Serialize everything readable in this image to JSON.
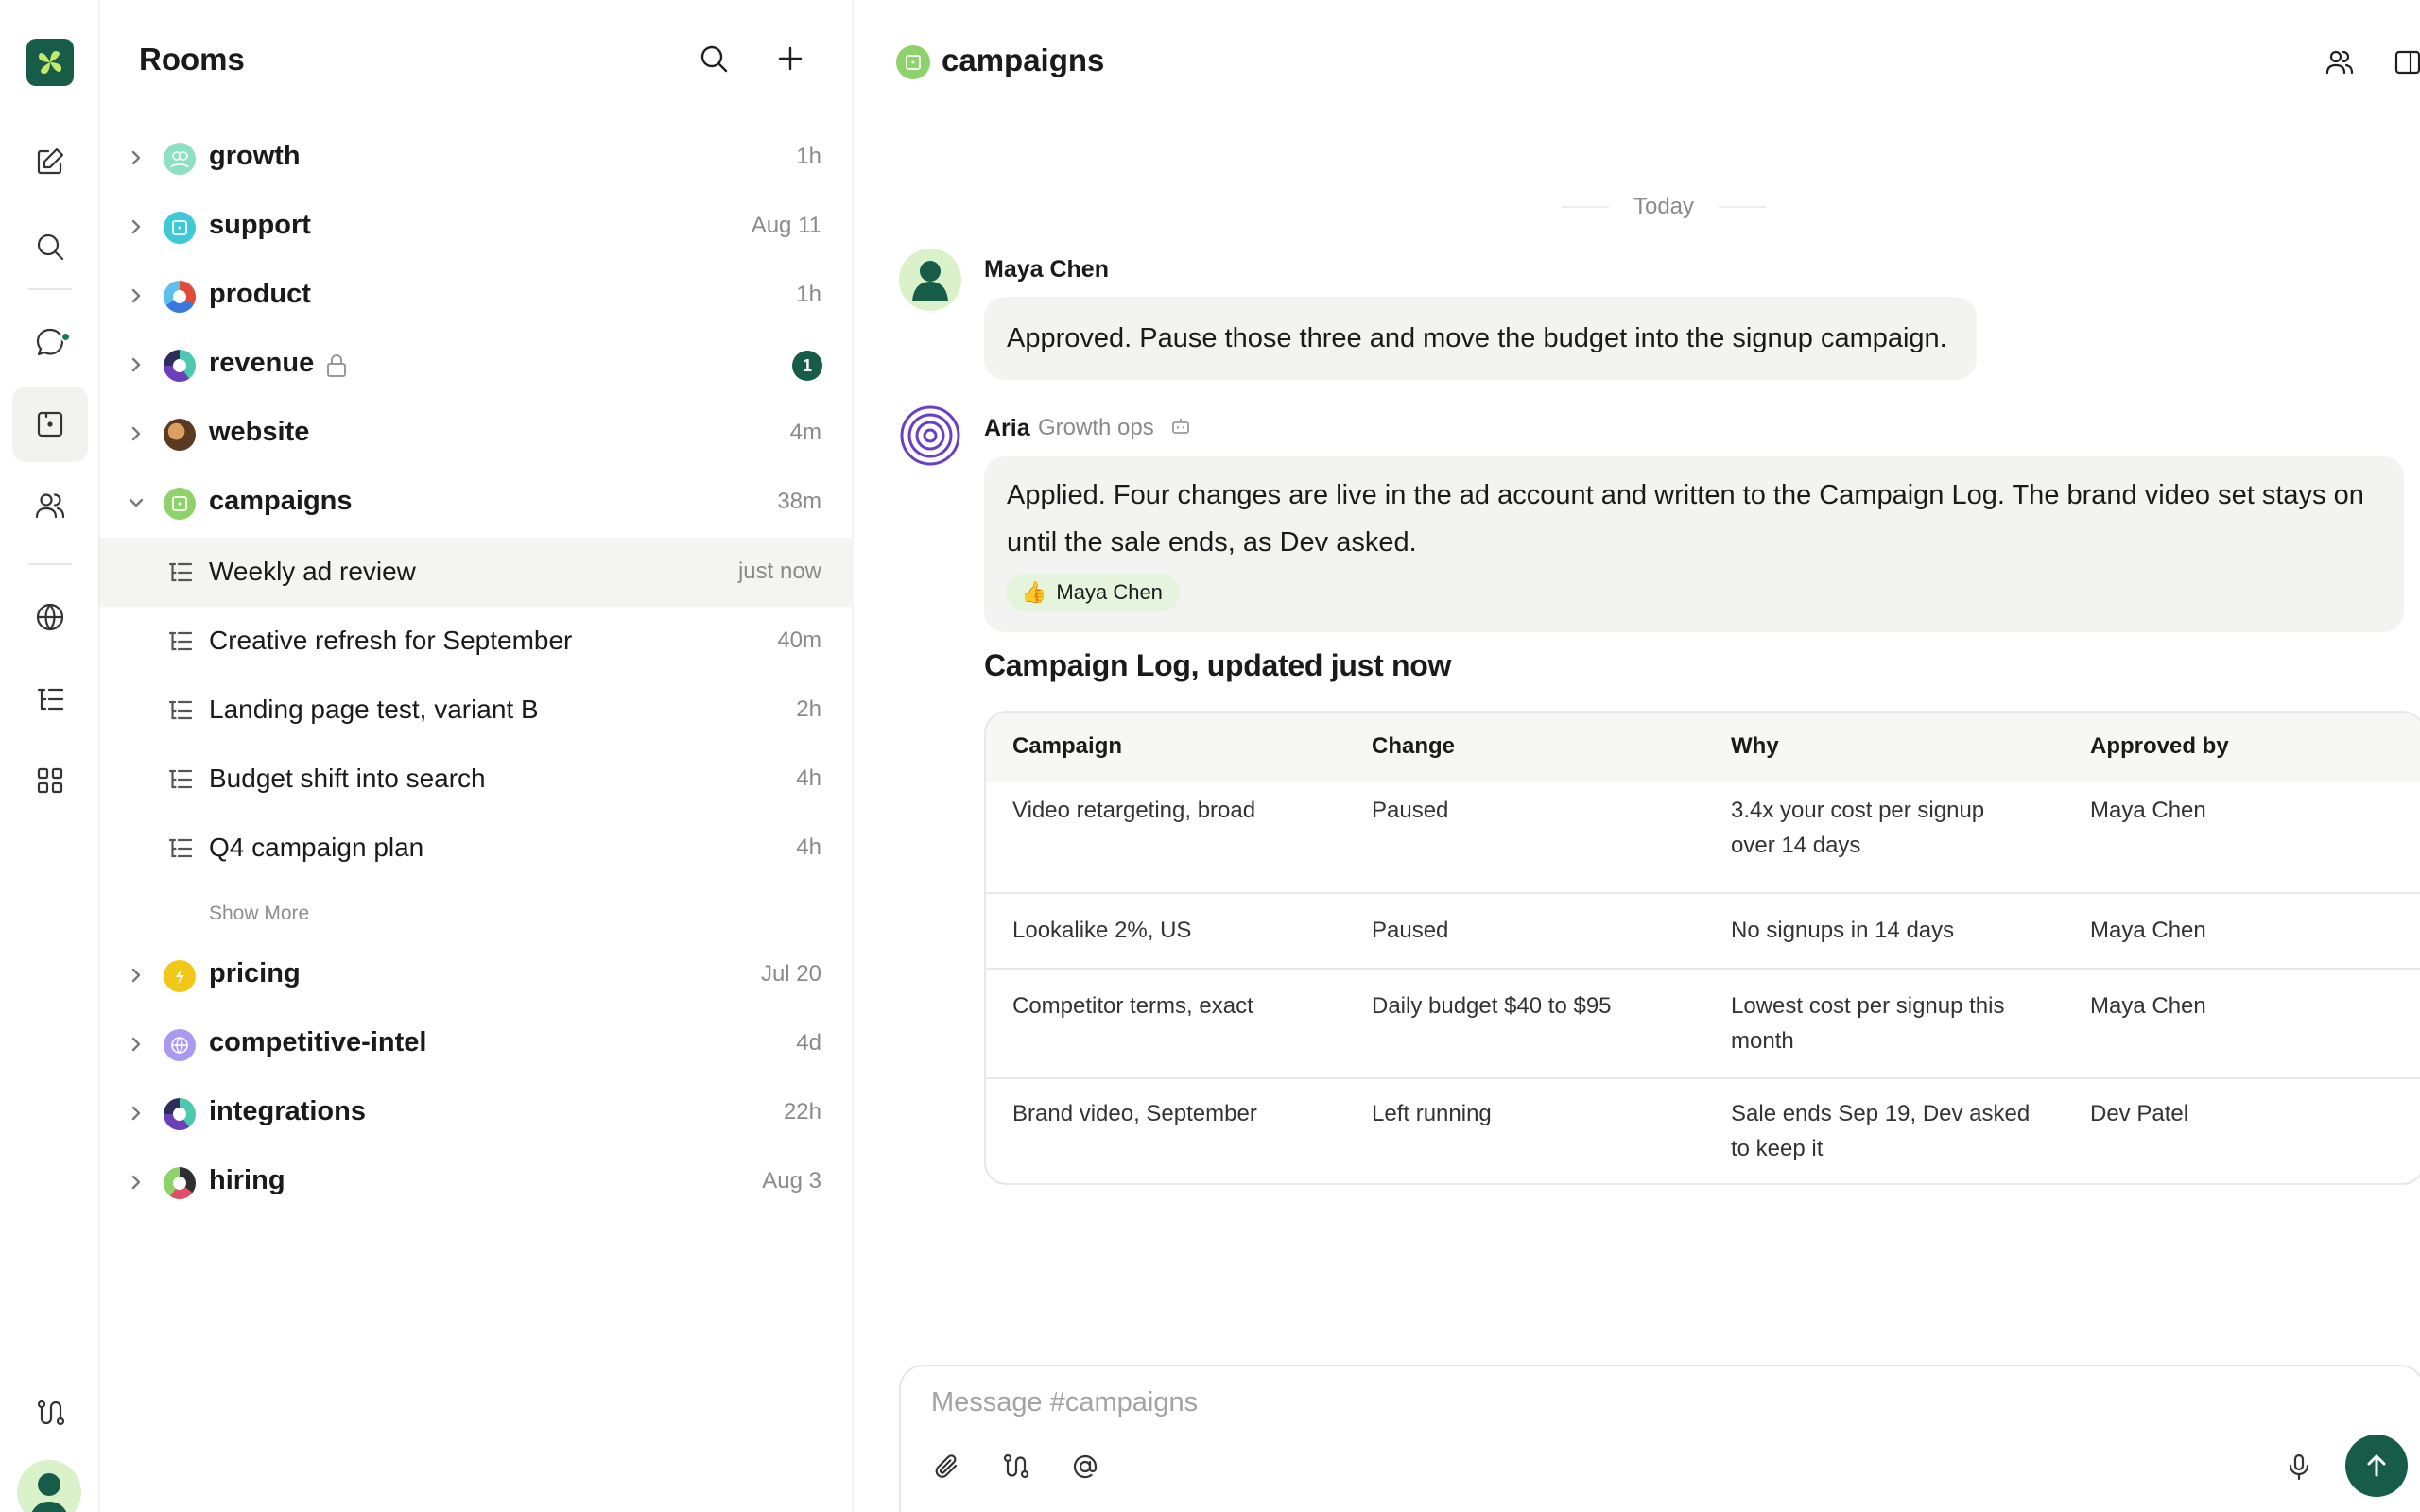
{
  "rooms_panel": {
    "title": "Rooms",
    "rooms_top": [
      {
        "name": "growth",
        "time": "1h"
      },
      {
        "name": "support",
        "time": "Aug 11"
      },
      {
        "name": "product",
        "time": "1h"
      },
      {
        "name": "revenue",
        "time": "",
        "badge": "1"
      },
      {
        "name": "website",
        "time": "4m"
      },
      {
        "name": "campaigns",
        "time": "38m"
      }
    ],
    "threads": [
      {
        "name": "Weekly ad review",
        "time": "just now"
      },
      {
        "name": "Creative refresh for September",
        "time": "40m"
      },
      {
        "name": "Landing page test, variant B",
        "time": "2h"
      },
      {
        "name": "Budget shift into search",
        "time": "4h"
      },
      {
        "name": "Q4 campaign plan",
        "time": "4h"
      }
    ],
    "show_more": "Show More",
    "rooms_bottom": [
      {
        "name": "pricing",
        "time": "Jul 20"
      },
      {
        "name": "competitive-intel",
        "time": "4d"
      },
      {
        "name": "integrations",
        "time": "22h"
      },
      {
        "name": "hiring",
        "time": "Aug 3"
      }
    ]
  },
  "channel": {
    "title": "campaigns",
    "day_separator": "Today"
  },
  "messages": [
    {
      "author": "Maya Chen",
      "text": "Approved. Pause those three and move the budget into the signup campaign."
    },
    {
      "author": "Aria",
      "role": "Growth ops",
      "text": "Applied. Four changes are live in the ad account and written to the Campaign Log. The brand video set stays on until the sale ends, as Dev asked.",
      "reaction": {
        "emoji": "👍",
        "label": "Maya Chen"
      }
    }
  ],
  "campaign_log": {
    "title": "Campaign Log, updated just now",
    "columns": [
      "Campaign",
      "Change",
      "Why",
      "Approved by"
    ],
    "rows": [
      {
        "campaign": "Video retargeting, broad",
        "change": "Paused",
        "why_1": "3.4x your cost per signup",
        "why_2": "over 14 days",
        "approved": "Maya Chen"
      },
      {
        "campaign": "Lookalike 2%, US",
        "change": "Paused",
        "why_1": "No signups in 14 days",
        "why_2": "",
        "approved": "Maya Chen"
      },
      {
        "campaign": "Competitor terms, exact",
        "change": "Daily budget $40 to $95",
        "why_1": "Lowest cost per signup this",
        "why_2": "month",
        "approved": "Maya Chen"
      },
      {
        "campaign": "Brand video, September",
        "change": "Left running",
        "why_1": "Sale ends Sep 19, Dev asked",
        "why_2": "to keep it",
        "approved": "Dev Patel"
      }
    ]
  },
  "composer": {
    "placeholder": "Message #campaigns"
  },
  "colors": {
    "brand": "#175c48",
    "bubble": "#f3f4f1",
    "reaction": "#e5f4dc",
    "campaigns_room": "#8dd26a"
  }
}
